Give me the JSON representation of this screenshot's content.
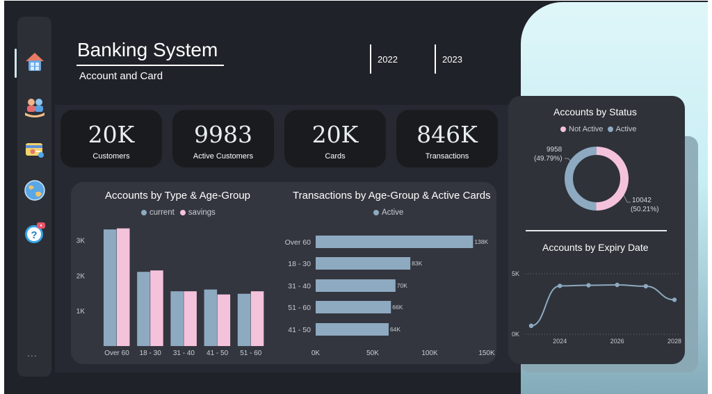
{
  "header": {
    "title": "Banking System",
    "subtitle": "Account and Card"
  },
  "year_filters": [
    "2022",
    "2023"
  ],
  "sidebar": {
    "items": [
      {
        "icon": "home-icon",
        "active": true
      },
      {
        "icon": "customers-icon",
        "active": false
      },
      {
        "icon": "card-icon",
        "active": false
      },
      {
        "icon": "globe-icon",
        "active": false
      },
      {
        "icon": "help-icon",
        "active": false
      }
    ],
    "more": "..."
  },
  "kpis": [
    {
      "value": "20K",
      "label": "Customers"
    },
    {
      "value": "9983",
      "label": "Active Customers"
    },
    {
      "value": "20K",
      "label": "Cards"
    },
    {
      "value": "846K",
      "label": "Transactions"
    }
  ],
  "colors": {
    "current": "#8eaac1",
    "savings": "#f5c2dc",
    "active": "#8eaac1",
    "not_active": "#f5c2dc",
    "line": "#8eaac1"
  },
  "chart_data": [
    {
      "type": "bar",
      "title": "Accounts by Type & Age-Group",
      "categories": [
        "Over 60",
        "18 - 30",
        "31 - 40",
        "41 - 50",
        "51 - 60"
      ],
      "series": [
        {
          "name": "current",
          "values": [
            3300,
            2100,
            1550,
            1600,
            1480
          ]
        },
        {
          "name": "savings",
          "values": [
            3330,
            2140,
            1550,
            1460,
            1550
          ]
        }
      ],
      "yticks": [
        "1K",
        "2K",
        "3K"
      ],
      "ylim": [
        0,
        3500
      ]
    },
    {
      "type": "bar",
      "orientation": "horizontal",
      "title": "Transactions by Age-Group & Active Cards",
      "categories": [
        "Over 60",
        "18 - 30",
        "31 - 40",
        "51 - 60",
        "41 - 50"
      ],
      "series": [
        {
          "name": "Active",
          "values": [
            138,
            83,
            70,
            66,
            64
          ],
          "labels": [
            "138K",
            "83K",
            "70K",
            "66K",
            "64K"
          ]
        }
      ],
      "xticks": [
        "0K",
        "50K",
        "100K",
        "150K"
      ],
      "xlim": [
        0,
        150
      ]
    },
    {
      "type": "pie",
      "donut": true,
      "title": "Accounts by Status",
      "legend": [
        "Not Active",
        "Active"
      ],
      "slices": [
        {
          "name": "Not Active",
          "value": 10042,
          "label": "10042",
          "pct": "(50.21%)"
        },
        {
          "name": "Active",
          "value": 9958,
          "label": "9958",
          "pct": "(49.79%)"
        }
      ]
    },
    {
      "type": "line",
      "title": "Accounts by Expiry Date",
      "x": [
        2023,
        2024,
        2025,
        2026,
        2027,
        2028
      ],
      "y": [
        700,
        4000,
        4050,
        4080,
        3970,
        2850
      ],
      "xticks": [
        "2024",
        "2026",
        "2028"
      ],
      "yticks": [
        "0K",
        "5K"
      ],
      "ylim": [
        0,
        5000
      ]
    }
  ]
}
